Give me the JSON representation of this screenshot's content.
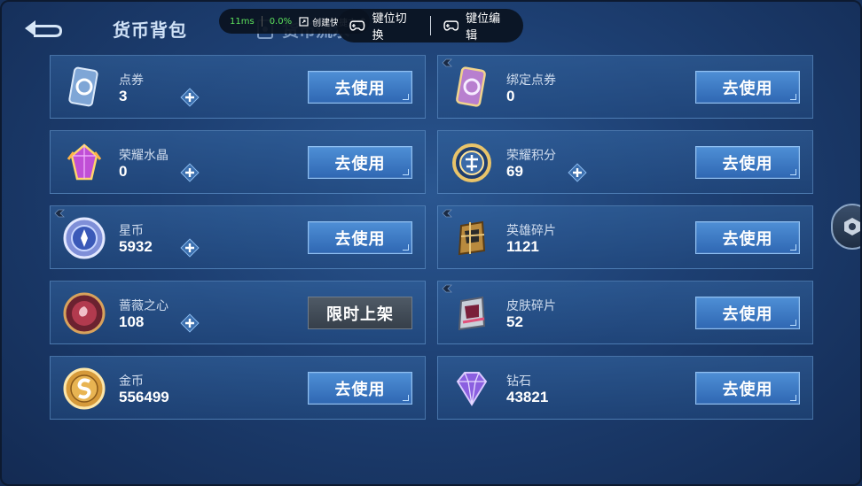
{
  "header": {
    "title": "货币背包",
    "tab_flow": "货币流水"
  },
  "overlay": {
    "ping": "11ms",
    "loss": "0.0%",
    "shortcut": "创建快捷方式",
    "key_switch": "键位切换",
    "key_edit": "键位编辑"
  },
  "currencies": [
    {
      "name": "点券",
      "value": "3",
      "button": "去使用",
      "icon": "ticket-icon"
    },
    {
      "name": "绑定点券",
      "value": "0",
      "button": "去使用",
      "icon": "bound-ticket-icon"
    },
    {
      "name": "荣耀水晶",
      "value": "0",
      "button": "去使用",
      "icon": "crystal-icon"
    },
    {
      "name": "荣耀积分",
      "value": "69",
      "button": "去使用",
      "icon": "points-icon"
    },
    {
      "name": "星币",
      "value": "5932",
      "button": "去使用",
      "icon": "star-coin-icon"
    },
    {
      "name": "英雄碎片",
      "value": "1121",
      "button": "去使用",
      "icon": "hero-shard-icon"
    },
    {
      "name": "蔷薇之心",
      "value": "108",
      "button": "限时上架",
      "icon": "rose-heart-icon"
    },
    {
      "name": "皮肤碎片",
      "value": "52",
      "button": "去使用",
      "icon": "skin-shard-icon"
    },
    {
      "name": "金币",
      "value": "556499",
      "button": "去使用",
      "icon": "gold-coin-icon"
    },
    {
      "name": "钻石",
      "value": "43821",
      "button": "去使用",
      "icon": "diamond-icon"
    }
  ]
}
